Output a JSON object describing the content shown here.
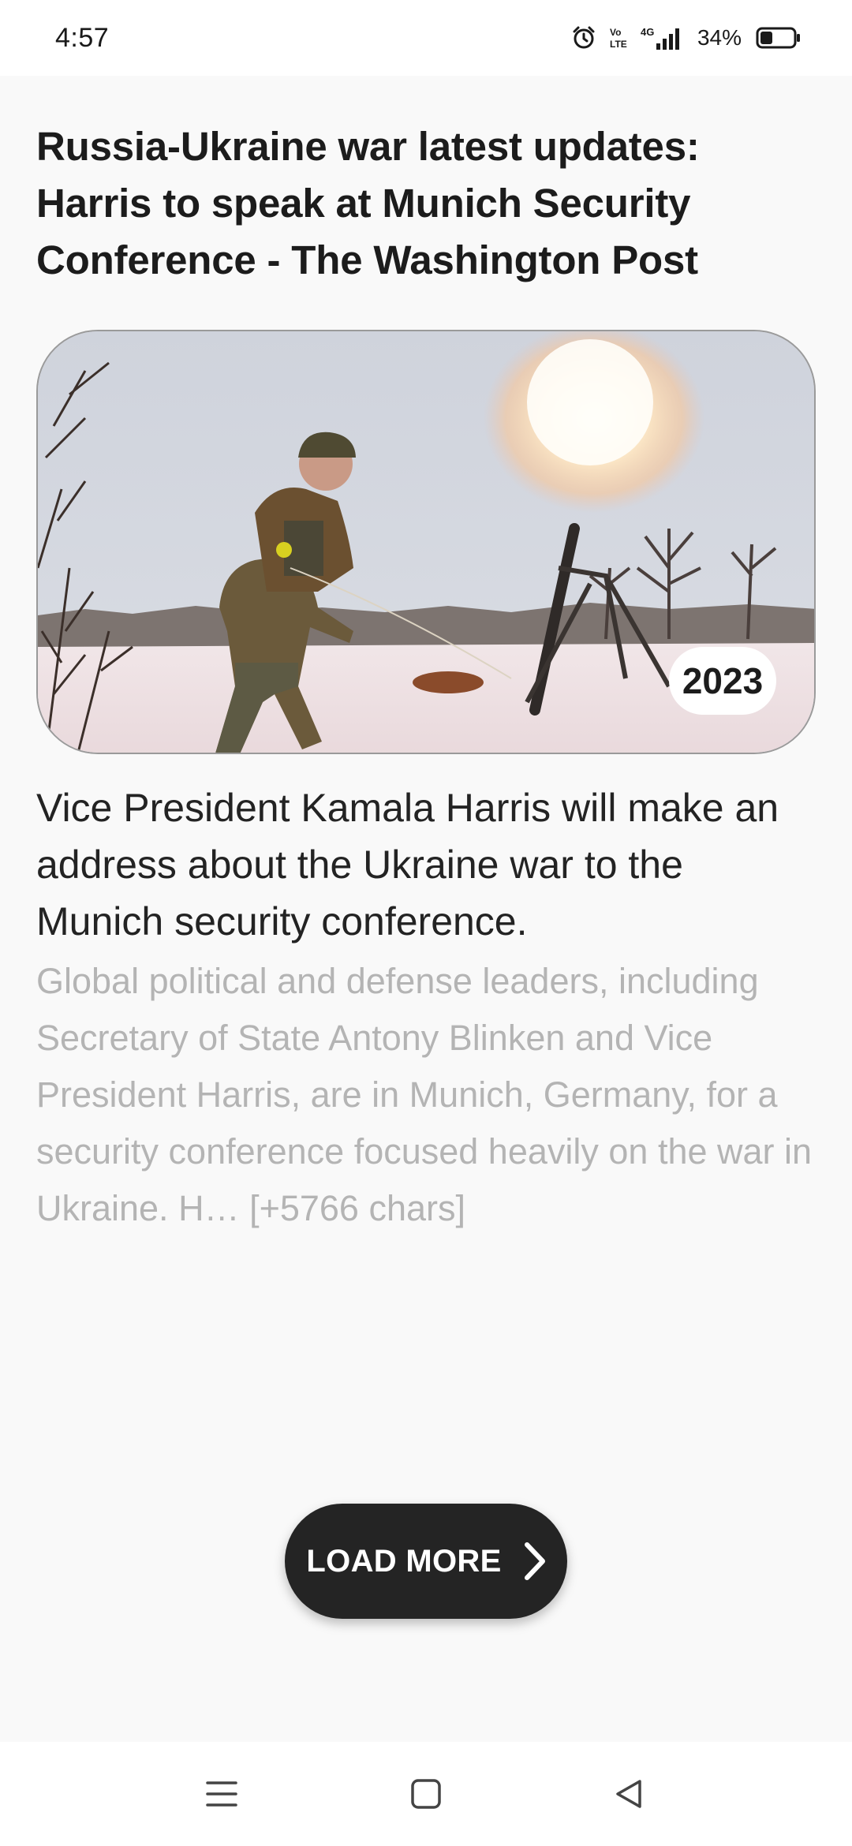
{
  "status_bar": {
    "time": "4:57",
    "network": "4G",
    "battery": "34%",
    "icons": [
      "alarm-icon",
      "volte-icon",
      "signal-icon",
      "battery-icon"
    ]
  },
  "article": {
    "headline": "Russia-Ukraine war latest updates: Harris to speak at Munich Security Conference - The Washington Post",
    "year_badge": "2023",
    "subheadline": "Vice President Kamala Harris will make an address about the Ukraine war to the Munich security conference.",
    "description": "Global political and defense leaders, including Secretary of State Antony Blinken and Vice President Harris, are in Munich, Germany, for a security conference focused heavily on the war in Ukraine. H… [+5766 chars]"
  },
  "load_more": {
    "label": "LOAD MORE"
  },
  "nav": {
    "icons": [
      "menu-icon",
      "home-square-icon",
      "back-triangle-icon"
    ]
  },
  "colors": {
    "button_bg": "#242424",
    "background": "#f9f9f9",
    "muted_text": "#b4b4b4"
  }
}
